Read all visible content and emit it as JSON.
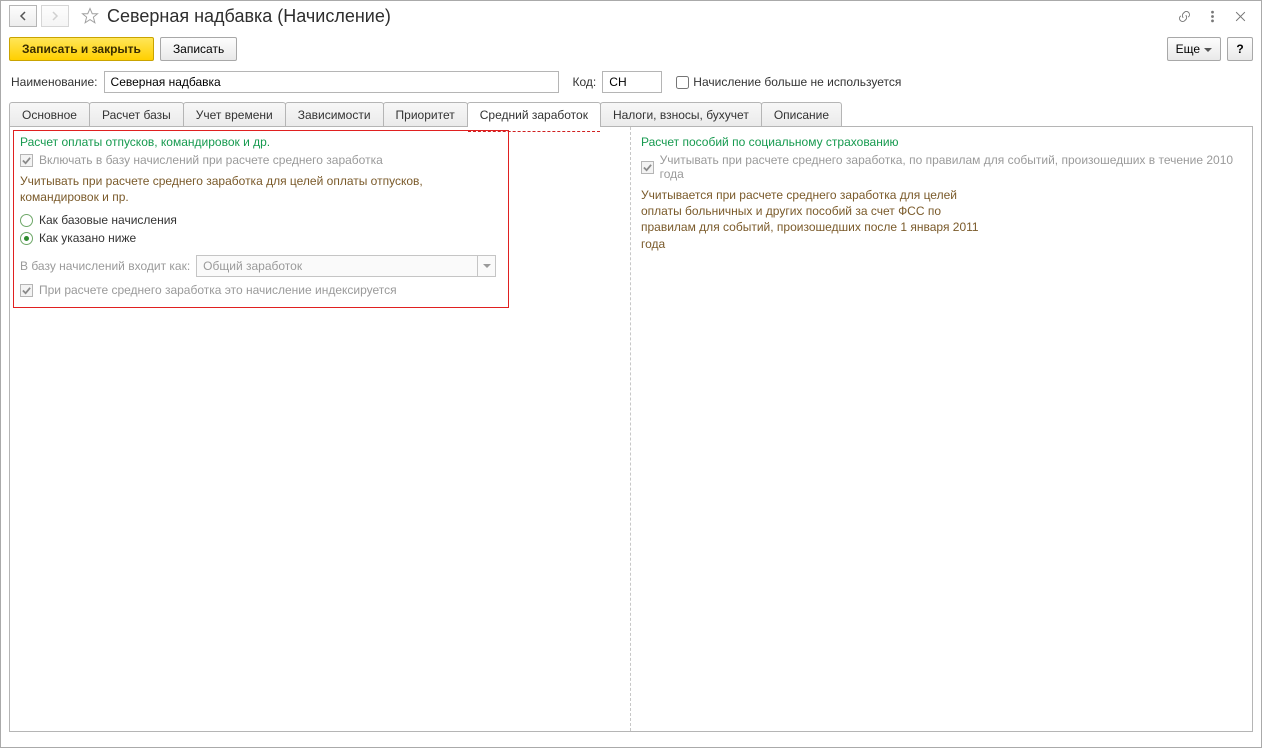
{
  "header": {
    "title": "Северная надбавка (Начисление)"
  },
  "toolbar": {
    "save_close": "Записать и закрыть",
    "save": "Записать",
    "more": "Еще",
    "help": "?"
  },
  "fields": {
    "name_label": "Наименование:",
    "name_value": "Северная надбавка",
    "code_label": "Код:",
    "code_value": "СН",
    "not_used_label": "Начисление больше не используется"
  },
  "tabs": [
    {
      "label": "Основное"
    },
    {
      "label": "Расчет базы"
    },
    {
      "label": "Учет времени"
    },
    {
      "label": "Зависимости"
    },
    {
      "label": "Приоритет"
    },
    {
      "label": "Средний заработок",
      "active": true
    },
    {
      "label": "Налоги, взносы, бухучет"
    },
    {
      "label": "Описание"
    }
  ],
  "left": {
    "section": "Расчет оплаты отпусков, командировок и др.",
    "include": "Включать в базу начислений при расчете среднего заработка",
    "note": "Учитывать при расчете среднего заработка для целей оплаты отпусков, командировок и пр.",
    "radio1": "Как базовые начисления",
    "radio2": "Как указано ниже",
    "select_label": "В базу начислений входит как:",
    "select_value": "Общий заработок",
    "index_label": "При расчете среднего заработка это начисление индексируется"
  },
  "right": {
    "section": "Расчет пособий по социальному страхованию",
    "include": "Учитывать при расчете среднего заработка, по правилам для событий, произошедших в течение 2010 года",
    "note": "Учитывается при расчете среднего заработка для целей оплаты больничных и других пособий за счет ФСС по правилам для событий, произошедших после 1 января 2011 года"
  }
}
